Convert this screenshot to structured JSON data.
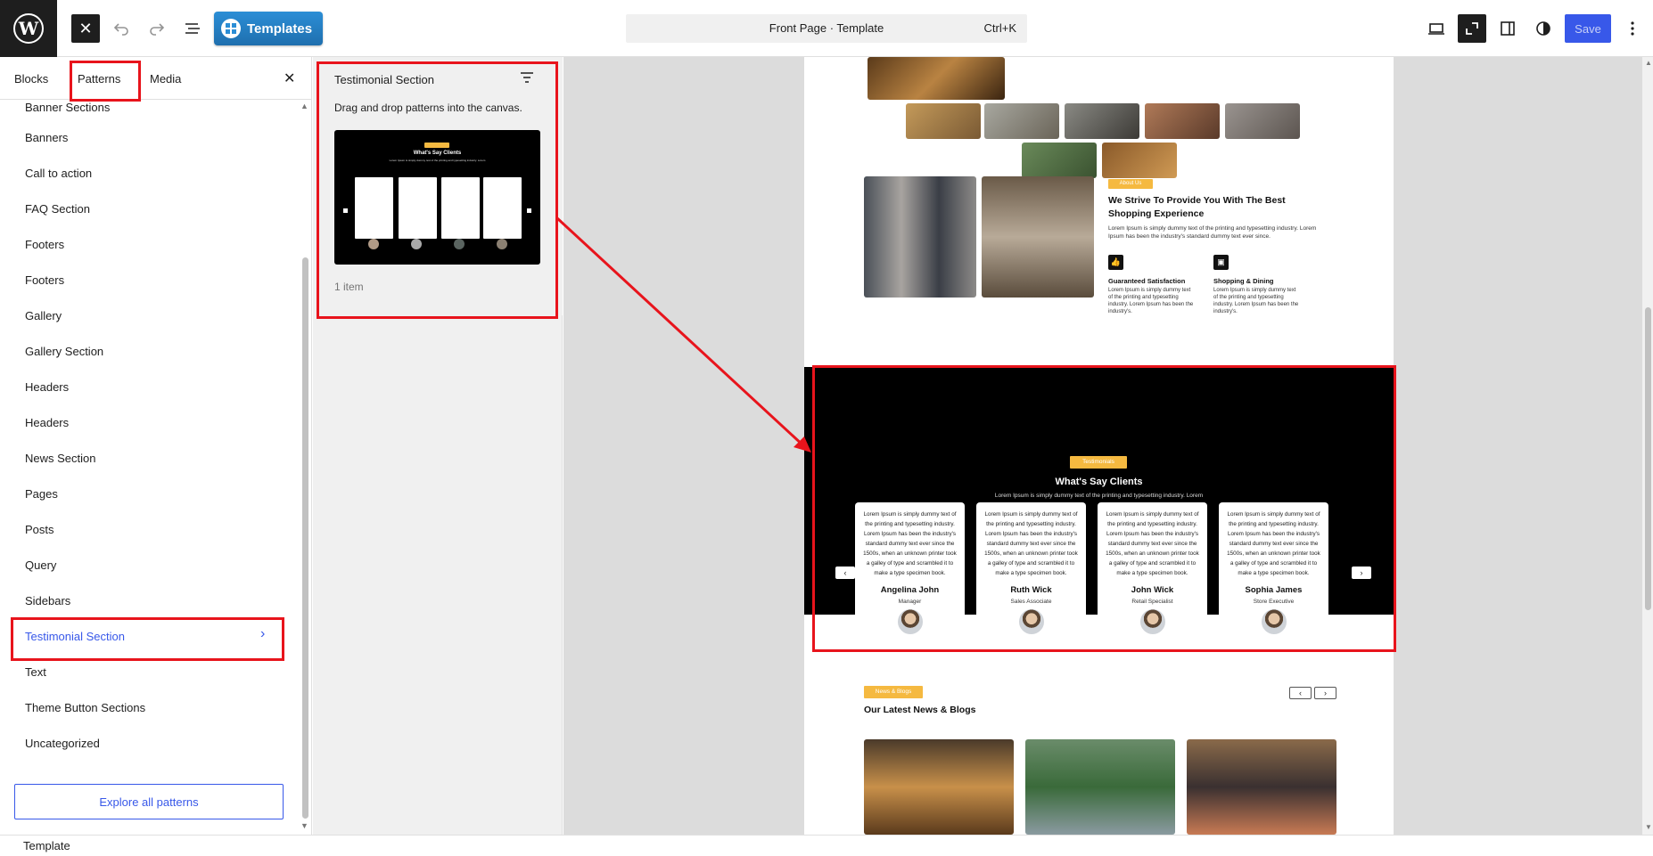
{
  "topbar": {
    "templates_label": "Templates",
    "doc_title": "Front Page · Template",
    "doc_shortcut": "Ctrl+K",
    "save_label": "Save"
  },
  "sidebar": {
    "tabs": [
      "Blocks",
      "Patterns",
      "Media"
    ],
    "active_tab": "Patterns",
    "categories": [
      "Banner Sections",
      "Banners",
      "Call to action",
      "FAQ Section",
      "Footers",
      "Footers",
      "Gallery",
      "Gallery Section",
      "Headers",
      "Headers",
      "News Section",
      "Pages",
      "Posts",
      "Query",
      "Sidebars",
      "Testimonial Section",
      "Text",
      "Theme Button Sections",
      "Uncategorized"
    ],
    "selected_category": "Testimonial Section",
    "explore_label": "Explore all patterns"
  },
  "pattern_panel": {
    "title": "Testimonial Section",
    "description": "Drag and drop patterns into the canvas.",
    "count_label": "1 item",
    "preview": {
      "badge": "Testimonials",
      "heading": "What's Say Clients",
      "sub": "Lorem Ipsum is simply dummy text of the printing and typesetting industry. Lorem",
      "names": [
        "Angelina John",
        "Ruth Wick",
        "John Wick",
        "Sophia James"
      ]
    }
  },
  "canvas": {
    "about": {
      "badge": "About Us",
      "heading": "We Strive To Provide You With The Best Shopping Experience",
      "body": "Lorem Ipsum is simply dummy text of the printing and typesetting industry. Lorem Ipsum has been the industry's standard dummy text ever since.",
      "features": [
        {
          "title": "Guaranteed Satisfaction",
          "text": "Lorem Ipsum is simply dummy text of the printing and typesetting industry. Lorem Ipsum has been the industry's."
        },
        {
          "title": "Shopping & Dining",
          "text": "Lorem Ipsum is simply dummy text of the printing and typesetting industry. Lorem Ipsum has been the industry's."
        }
      ]
    },
    "testimonials": {
      "badge": "Testimonials",
      "heading": "What's Say Clients",
      "sub": "Lorem Ipsum is simply dummy text of the printing and typesetting industry. Lorem",
      "quote": "Lorem Ipsum is simply dummy text of the printing and typesetting industry. Lorem Ipsum has been the industry's standard dummy text ever since the 1500s, when an unknown printer took a galley of type and scrambled it to make a type specimen book.",
      "cards": [
        {
          "name": "Angelina John",
          "role": "Manager"
        },
        {
          "name": "Ruth Wick",
          "role": "Sales Associate"
        },
        {
          "name": "John Wick",
          "role": "Retail Specialist"
        },
        {
          "name": "Sophia James",
          "role": "Store Executive"
        }
      ]
    },
    "news": {
      "badge": "News & Blogs",
      "heading": "Our Latest News & Blogs"
    }
  },
  "footer": {
    "breadcrumb": "Template"
  },
  "colors": {
    "accent": "#3858e9",
    "highlight": "#e8141c",
    "badge": "#f5b940",
    "dark": "#1e1e1e"
  }
}
